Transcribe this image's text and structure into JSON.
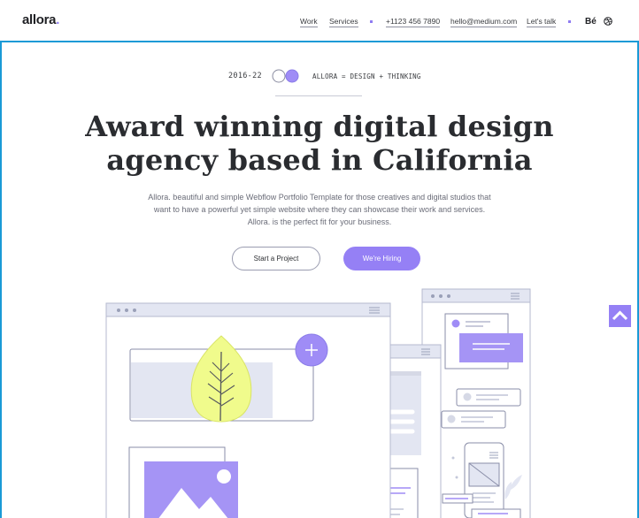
{
  "header": {
    "logo": "allora",
    "logo_dot": ".",
    "nav": {
      "work": "Work",
      "services": "Services",
      "phone": "+1123 456 7890",
      "email": "hello@medium.com",
      "talk": "Let's talk",
      "behance": "Bé"
    },
    "icons": {
      "social": "dribbble-icon",
      "separator": "square-dot"
    }
  },
  "hero": {
    "years": "2016-22",
    "tagline": "ALLORA = DESIGN + THINKING",
    "title_line1": "Award winning digital design",
    "title_line2": "agency based in California",
    "description": "Allora. beautiful and simple Webflow Portfolio Template for those creatives and digital studios that want to have a powerful yet simple website where they can showcase their work and services. Allora. is the perfect fit for your business.",
    "cta_primary": "Start a Project",
    "cta_secondary": "We're Hiring"
  },
  "colors": {
    "accent": "#9580f5",
    "frame_border": "#1a9ad6",
    "leaf": "#f0fb8c",
    "text": "#2a2c30",
    "muted": "#6a6c78",
    "panel": "#e3e6f2"
  },
  "scroll_top": {
    "icon": "chevron-up-icon"
  }
}
